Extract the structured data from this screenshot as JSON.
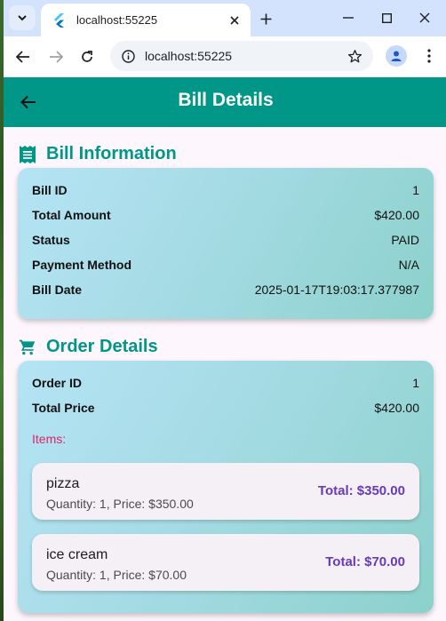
{
  "browser": {
    "tab_title": "localhost:55225",
    "url": "localhost:55225"
  },
  "appbar": {
    "title": "Bill Details"
  },
  "bill_info": {
    "heading": "Bill Information",
    "rows": [
      {
        "label": "Bill ID",
        "value": "1"
      },
      {
        "label": "Total Amount",
        "value": "$420.00"
      },
      {
        "label": "Status",
        "value": "PAID"
      },
      {
        "label": "Payment Method",
        "value": "N/A"
      },
      {
        "label": "Bill Date",
        "value": "2025-01-17T19:03:17.377987"
      }
    ]
  },
  "order_details": {
    "heading": "Order Details",
    "rows": [
      {
        "label": "Order ID",
        "value": "1"
      },
      {
        "label": "Total Price",
        "value": "$420.00"
      }
    ],
    "items_label": "Items:",
    "items": [
      {
        "name": "pizza",
        "sub": "Quantity: 1, Price: $350.00",
        "total": "Total: $350.00"
      },
      {
        "name": "ice cream",
        "sub": "Quantity: 1, Price: $70.00",
        "total": "Total: $70.00"
      }
    ]
  },
  "colors": {
    "primary": "#009688",
    "items_label": "#e0246a",
    "item_total": "#673ab7"
  }
}
